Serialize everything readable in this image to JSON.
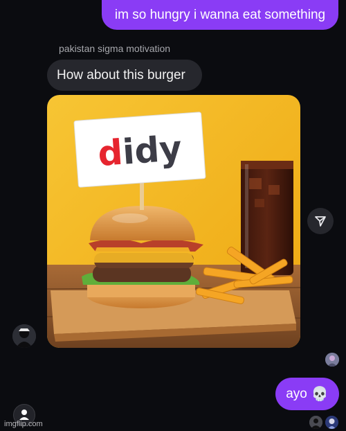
{
  "chat": {
    "messages": [
      {
        "from": "me",
        "text": "im so hungry i wanna eat something"
      },
      {
        "from": "other",
        "sender": "pakistan sigma motivation",
        "text": "How about this burger"
      },
      {
        "from": "other",
        "type": "image",
        "sign_text": "didy"
      },
      {
        "from": "me",
        "text": "ayo",
        "emoji": "💀"
      }
    ]
  },
  "colors": {
    "background": "#0b0c10",
    "outgoing_bubble": "#8a3cf5",
    "incoming_bubble": "#26272d",
    "sign_d": "#e6252f",
    "sign_rest": "#3d3d47",
    "photo_bg": "#f4b81c"
  },
  "icons": {
    "share": "send-arrow-icon",
    "profile": "person-icon"
  },
  "watermark": "imgflip.com"
}
